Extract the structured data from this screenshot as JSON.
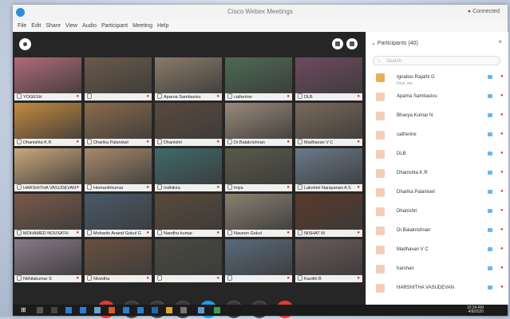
{
  "window": {
    "title": "Cisco Webex Meetings",
    "connection_status": "Connected"
  },
  "menu": [
    "File",
    "Edit",
    "Share",
    "View",
    "Audio",
    "Participant",
    "Meeting",
    "Help"
  ],
  "tiles": [
    {
      "name": "YOGESH",
      "color": "#b06a7a"
    },
    {
      "name": "",
      "color": "#6b5a4a"
    },
    {
      "name": "Aparna Sambasivu",
      "color": "#8a7b6a"
    },
    {
      "name": "catherine",
      "color": "#4e6a52"
    },
    {
      "name": "DLB",
      "color": "#6e4a5e"
    },
    {
      "name": "Dhanishta K.R",
      "color": "#c48a3e"
    },
    {
      "name": "Dharika Palaniswl",
      "color": "#8b6b4b"
    },
    {
      "name": "Dhanishri",
      "color": "#5a4a3e"
    },
    {
      "name": "Dr.Balakrishnan",
      "color": "#9a8a7a"
    },
    {
      "name": "Madhavan V C",
      "color": "#7a6a5a"
    },
    {
      "name": "HARSHITHA VASUDEVAN",
      "color": "#caa87a"
    },
    {
      "name": "Hemanthkumar",
      "color": "#a88a6a"
    },
    {
      "name": "Indhikira",
      "color": "#3e6a6a"
    },
    {
      "name": "Iniya",
      "color": "#5a5a4a"
    },
    {
      "name": "Lakshmi Narayanan A S",
      "color": "#6a7a8a"
    },
    {
      "name": "MOHAMED NOUSATH",
      "color": "#7a5a4a"
    },
    {
      "name": "Mohanln Anand Gokul G",
      "color": "#4a5a6a"
    },
    {
      "name": "Nandhu kumar",
      "color": "#5a4a3a"
    },
    {
      "name": "Naveen Gokul",
      "color": "#8a8070"
    },
    {
      "name": "NISHAT M",
      "color": "#5a3a2a"
    },
    {
      "name": "Nithilakumar S",
      "color": "#8a7a88"
    },
    {
      "name": "Nivedha",
      "color": "#6a5040"
    },
    {
      "name": "",
      "color": "#4a4a40"
    },
    {
      "name": "",
      "color": "#5a6a7a"
    },
    {
      "name": "Kavithi B",
      "color": "#6a5a5a"
    }
  ],
  "participants": {
    "header": "Participants (40)",
    "search_placeholder": "Search",
    "list": [
      {
        "name": "Ignatius Rajathi G",
        "sub": "Host, me",
        "avatar": "#e8b050"
      },
      {
        "name": "Aparna Sambasivu",
        "sub": "",
        "avatar": "#f4cdb8"
      },
      {
        "name": "Bhavya Kumar N",
        "sub": "",
        "avatar": "#f4cdb8"
      },
      {
        "name": "catherine",
        "sub": "",
        "avatar": "#f4cdb8"
      },
      {
        "name": "DLB",
        "sub": "",
        "avatar": "#f4cdb8"
      },
      {
        "name": "Dhanishta K.R",
        "sub": "",
        "avatar": "#f4cdb8"
      },
      {
        "name": "Dharika Palaniswl",
        "sub": "",
        "avatar": "#f4cdb8"
      },
      {
        "name": "Dhanishri",
        "sub": "",
        "avatar": "#f4cdb8"
      },
      {
        "name": "Dr.Balakrishnan",
        "sub": "",
        "avatar": "#f4cdb8"
      },
      {
        "name": "Madhavan V C",
        "sub": "",
        "avatar": "#f4cdb8"
      },
      {
        "name": "harshan",
        "sub": "",
        "avatar": "#f4cdb8"
      },
      {
        "name": "HARSHITHA VASUDEVAN",
        "sub": "",
        "avatar": "#f4cdb8"
      }
    ]
  },
  "taskbar": {
    "time": "10:34 AM",
    "date": "4/8/2020"
  },
  "colors": {
    "mute_red": "#e53935",
    "accent_blue": "#1e9be8"
  }
}
